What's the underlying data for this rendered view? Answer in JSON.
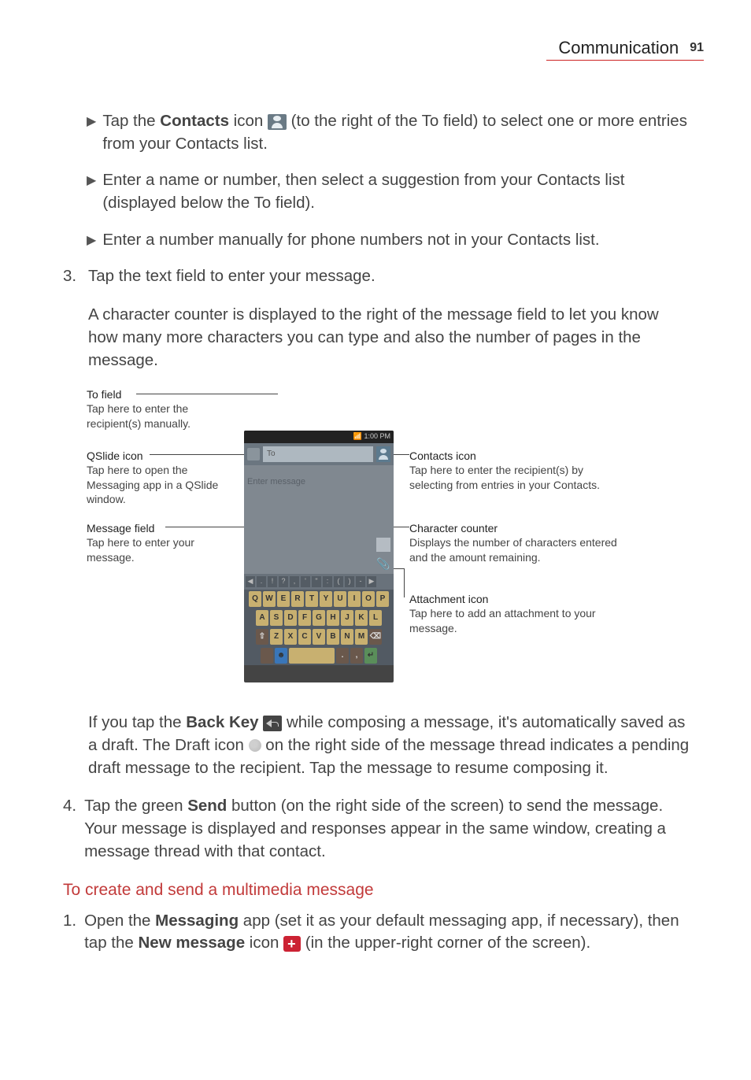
{
  "header": {
    "title": "Communication",
    "page": "91"
  },
  "bullets": {
    "b1_a": "Tap the ",
    "b1_bold": "Contacts",
    "b1_b": " icon ",
    "b1_c": " (to the right of the To field) to select one or more entries from your Contacts list.",
    "b2": "Enter a name or number, then select a suggestion from your Contacts list (displayed below the To field).",
    "b3": "Enter a number manually for phone numbers not in your Contacts list."
  },
  "step3_num": "3.",
  "step3_text": "Tap the text field to enter your message.",
  "step3_para": "A character counter is displayed to the right of the message field to let you know how many more characters you can type and also the number of pages in the message.",
  "callouts": {
    "to_field": {
      "title": "To field",
      "desc": "Tap here to enter the recipient(s) manually."
    },
    "qslide": {
      "title": "QSlide icon",
      "desc": "Tap here to open the Messaging app in a QSlide window."
    },
    "msg_field": {
      "title": "Message field",
      "desc": "Tap here to enter your message."
    },
    "contacts": {
      "title": "Contacts icon",
      "desc": "Tap here to enter the recipient(s) by selecting from entries in your Contacts."
    },
    "counter": {
      "title": "Character counter",
      "desc": "Displays the number of characters entered and the amount remaining."
    },
    "attach": {
      "title": "Attachment icon",
      "desc": "Tap here to add an attachment to your message."
    }
  },
  "phone": {
    "status": "1:00 PM",
    "to_placeholder": "To",
    "msg_placeholder": "Enter message"
  },
  "keyboard": {
    "row1": [
      "Q",
      "W",
      "E",
      "R",
      "T",
      "Y",
      "U",
      "I",
      "O",
      "P"
    ],
    "row2": [
      "A",
      "S",
      "D",
      "F",
      "G",
      "H",
      "J",
      "K",
      "L"
    ],
    "row3": [
      "Z",
      "X",
      "C",
      "V",
      "B",
      "N",
      "M"
    ]
  },
  "back_para_a": "If you tap the ",
  "back_key": "Back Key",
  "back_para_b": " while composing a message, it's automatically saved as a draft. The Draft icon ",
  "back_para_c": " on the right side of the message thread indicates a pending draft message to the recipient. Tap the message to resume composing it.",
  "step4_num": "4.",
  "step4_a": "Tap the green ",
  "step4_send": "Send",
  "step4_b": " button (on the right side of the screen) to send the message.",
  "step4_desc": "Your message is displayed and responses appear in the same window, creating a message thread with that contact.",
  "section_title": "To create and send a multimedia message",
  "step1_num": "1.",
  "step1_a": "Open the ",
  "step1_msg": "Messaging",
  "step1_b": " app (set it as your default messaging app, if necessary), then tap the ",
  "step1_new": "New message",
  "step1_c": " icon ",
  "step1_d": " (in the upper-right corner of the screen)."
}
